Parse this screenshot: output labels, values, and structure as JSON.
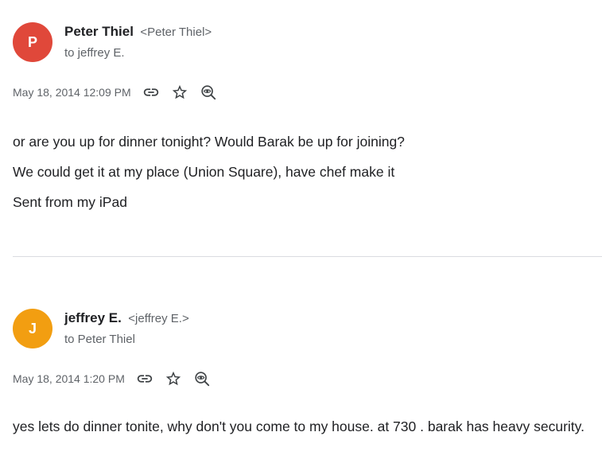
{
  "messages": [
    {
      "avatar_letter": "P",
      "avatar_color": "#e0483a",
      "sender_name": "Peter Thiel",
      "sender_email": "<Peter Thiel>",
      "to_line": "to jeffrey E.",
      "date": "May 18, 2014 12:09 PM",
      "body": [
        "or are you up for dinner tonight? Would Barak be up for joining?",
        "We could get it at my place (Union Square), have chef make it",
        "Sent from my iPad"
      ]
    },
    {
      "avatar_letter": "J",
      "avatar_color": "#f29e11",
      "sender_name": "jeffrey E.",
      "sender_email": "<jeffrey E.>",
      "to_line": "to Peter Thiel",
      "date": "May 18, 2014 1:20 PM",
      "body": [
        "yes lets do dinner tonite, why don't you come to my house. at 730 . barak has heavy security."
      ]
    }
  ],
  "icons": [
    "link-icon",
    "star-icon",
    "view-source-icon"
  ]
}
